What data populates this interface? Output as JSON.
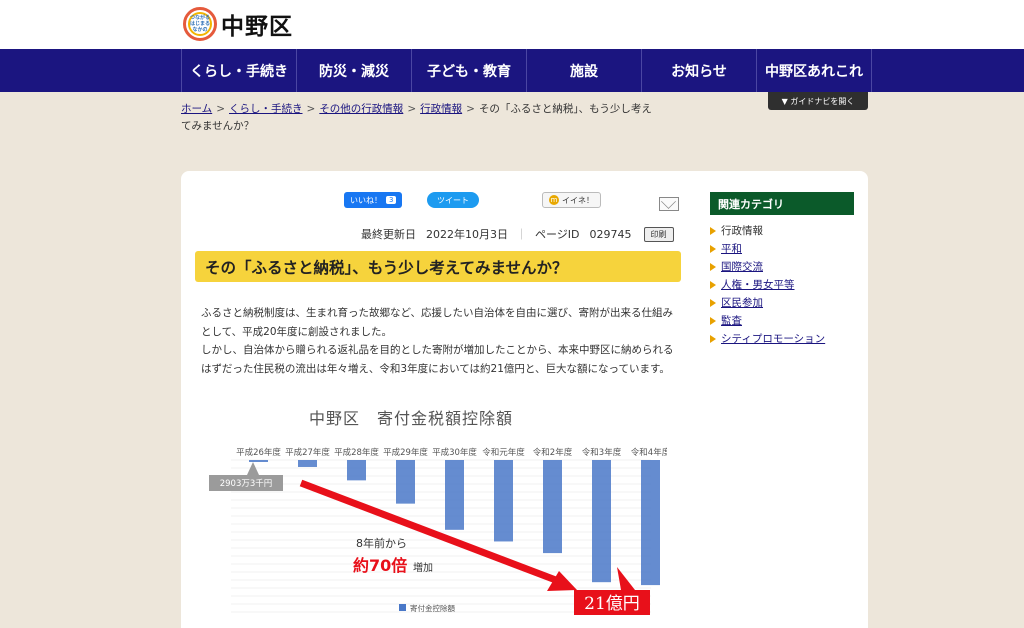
{
  "site": {
    "logo_mark_text": "つながる はじまる なかの",
    "name": "中野区"
  },
  "nav": {
    "items": [
      {
        "label": "くらし・手続き",
        "width": 115
      },
      {
        "label": "防災・減災",
        "width": 115
      },
      {
        "label": "子ども・教育",
        "width": 115
      },
      {
        "label": "施設",
        "width": 115
      },
      {
        "label": "お知らせ",
        "width": 115
      },
      {
        "label": "中野区あれこれ",
        "width": 115
      }
    ],
    "guide_button": "▼ ガイドナビを開く"
  },
  "breadcrumb": {
    "home": "ホーム",
    "sep": ">",
    "l1": "くらし・手続き",
    "l2": "その他の行政情報",
    "l3": "行政情報",
    "current": "その「ふるさと納税」、もう少し考えてみませんか？"
  },
  "social": {
    "fb_label": "いいね！",
    "fb_count": "3",
    "tweet_label": "ツイート",
    "iine_label": "イイネ！",
    "iine_mark": "m"
  },
  "meta": {
    "updated_label": "最終更新日",
    "updated_date": "2022年10月3日",
    "divider": "｜",
    "page_id_label": "ページID",
    "page_id": "029745",
    "print_label": "印刷"
  },
  "article": {
    "title": "その「ふるさと納税」、もう少し考えてみませんか？",
    "paragraph1": "ふるさと納税制度は、生まれ育った故郷など、応援したい自治体を自由に選び、寄附が出来る仕組みとして、平成20年度に創設されました。",
    "paragraph2": "しかし、自治体から贈られる返礼品を目的とした寄附が増加したことから、本来中野区に納められるはずだった住民税の流出は年々増え、令和3年度においては約21億円と、巨大な額になっています。"
  },
  "chart_data": {
    "type": "bar",
    "title": "中野区　寄付金税額控除額",
    "categories": [
      "平成26年度",
      "平成27年度",
      "平成28年度",
      "平成29年度",
      "平成30年度",
      "令和元年度",
      "令和2年度",
      "令和3年度",
      "令和4年度"
    ],
    "series": [
      {
        "name": "寄付金控除額",
        "values": [
          0.29,
          1.2,
          3.5,
          7.5,
          12.0,
          14.0,
          16.0,
          21.0,
          21.5
        ]
      }
    ],
    "ylim": [
      0,
      22
    ],
    "grid": true,
    "orientation": "downward",
    "annotations": {
      "start_label": "2903万3千円",
      "note_top": "8年前から",
      "note_big": "約70倍",
      "note_suffix": "増加",
      "end_label": "21億円"
    },
    "colors": {
      "bar": "#4a78c8",
      "arrow": "#e8101a",
      "label_bg": "#e8101a"
    }
  },
  "sidebar": {
    "heading": "関連カテゴリ",
    "items": [
      {
        "label": "行政情報",
        "link": false
      },
      {
        "label": "平和",
        "link": true
      },
      {
        "label": "国際交流",
        "link": true
      },
      {
        "label": "人権・男女平等",
        "link": true
      },
      {
        "label": "区民参加",
        "link": true
      },
      {
        "label": "監査",
        "link": true
      },
      {
        "label": "シティプロモーション",
        "link": true
      }
    ]
  },
  "colors": {
    "nav": "#1b1580",
    "title_bg": "#f6d33c",
    "side_head": "#0b5a2a",
    "background": "#ede6da"
  }
}
